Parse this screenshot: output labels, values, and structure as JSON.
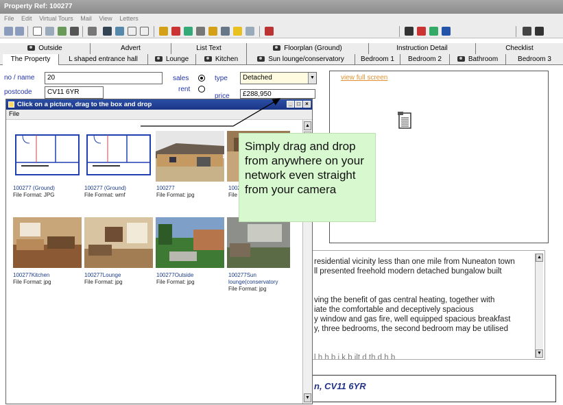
{
  "app": {
    "title": "Property Ref: 100277",
    "menu": [
      "File",
      "Edit",
      "Virtual Tours",
      "Mail",
      "View",
      "Letters"
    ]
  },
  "tabs_row1": [
    "Outside",
    "Advert",
    "List Text",
    "Floorplan (Ground)",
    "Instruction Detail",
    "Checklist"
  ],
  "tabs_row2": [
    "The Property",
    "L shaped entrance hall",
    "Lounge",
    "Kitchen",
    "Sun lounge/conservatory",
    "Bedroom 1",
    "Bedroom 2",
    "Bathroom",
    "Bedroom 3"
  ],
  "form": {
    "no_name_label": "no / name",
    "no_name_value": "20",
    "postcode_label": "postcode",
    "postcode_value": "CV11 6YR",
    "sales_label": "sales",
    "rent_label": "rent",
    "selected_mode": "sales",
    "type_label": "type",
    "type_value": "Detached",
    "price_label": "price",
    "price_value": "£288,950"
  },
  "preview": {
    "link": "view full screen"
  },
  "description_lines": [
    "residential vicinity less than one mile from Nuneaton town",
    "ll presented freehold modern detached bungalow built",
    "",
    "ving the benefit of gas central heating, together with",
    "iate the comfortable and deceptively spacious",
    "y window and gas fire, well equipped spacious breakfast",
    "y, three bedrooms, the second bedroom may be utilised",
    "",
    "l h   h   b i k b ilt            d th          d   h  b"
  ],
  "address_fragment": "n, CV11 6YR",
  "picker_window": {
    "title": "Click on a picture, drag to the box and drop",
    "menu": "File",
    "items": [
      {
        "name": "100277 (Ground)",
        "format": "File Format: JPG",
        "kind": "floorplan"
      },
      {
        "name": "100277 (Ground)",
        "format": "File Format: wmf",
        "kind": "floorplan"
      },
      {
        "name": "100277",
        "format": "File Format: jpg",
        "kind": "exterior"
      },
      {
        "name": "1002",
        "format": "File F",
        "kind": "photo"
      },
      {
        "name": "100277Kitchen",
        "format": "File Format: jpg",
        "kind": "kitchen"
      },
      {
        "name": "100277Lounge",
        "format": "File Format: jpg",
        "kind": "lounge"
      },
      {
        "name": "100277Outside",
        "format": "File Format: jpg",
        "kind": "garden"
      },
      {
        "name": "100277Sun lounge(conservatory",
        "format": "File Format: jpg",
        "kind": "sunlounge"
      }
    ]
  },
  "callout": {
    "text": "Simply drag and drop from anywhere on your network even straight from your camera"
  },
  "colors": {
    "callout_bg": "#d8f8cf",
    "title_blue": "#1b3586",
    "link_orange": "#e09030"
  }
}
